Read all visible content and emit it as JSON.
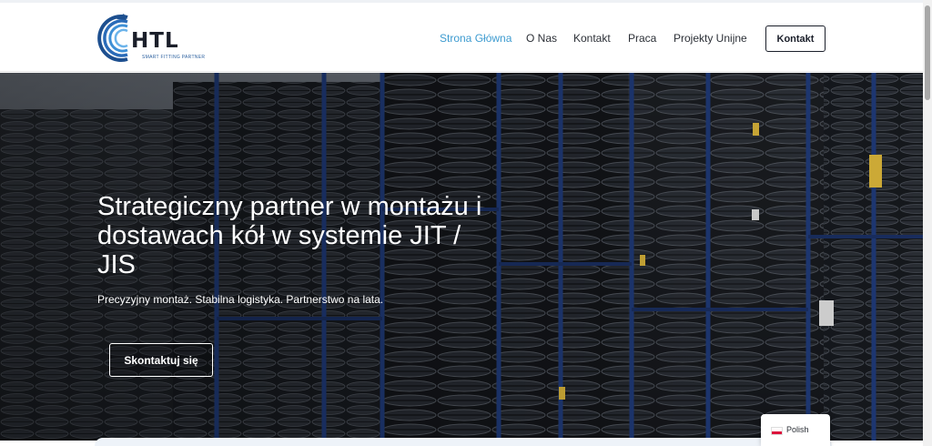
{
  "header": {
    "logo": {
      "text": "HTL",
      "tagline": "SMART FITTING PARTNER",
      "colors": {
        "ring": "#2a6bb8",
        "text": "#1b1f2a"
      }
    },
    "nav": [
      {
        "label": "Strona Główna",
        "active": true
      },
      {
        "label": "O Nas",
        "active": false
      },
      {
        "label": "Kontakt",
        "active": false
      },
      {
        "label": "Praca",
        "active": false
      },
      {
        "label": "Projekty Unijne",
        "active": false
      }
    ],
    "cta_label": "Kontakt"
  },
  "hero": {
    "title": "Strategiczny partner w montażu i dostawach kół w systemie JIT / JIS",
    "subtitle": "Precyzyjny montaż. Stabilna logistyka. Partnerstwo na lata.",
    "cta_label": "Skontaktuj się",
    "background": "tire-warehouse-racks"
  },
  "language_switcher": {
    "label": "Polish",
    "flag": "poland-flag-icon"
  },
  "colors": {
    "accent": "#3d9bd0",
    "text_dark": "#2b2f36",
    "hero_text": "#ffffff"
  }
}
